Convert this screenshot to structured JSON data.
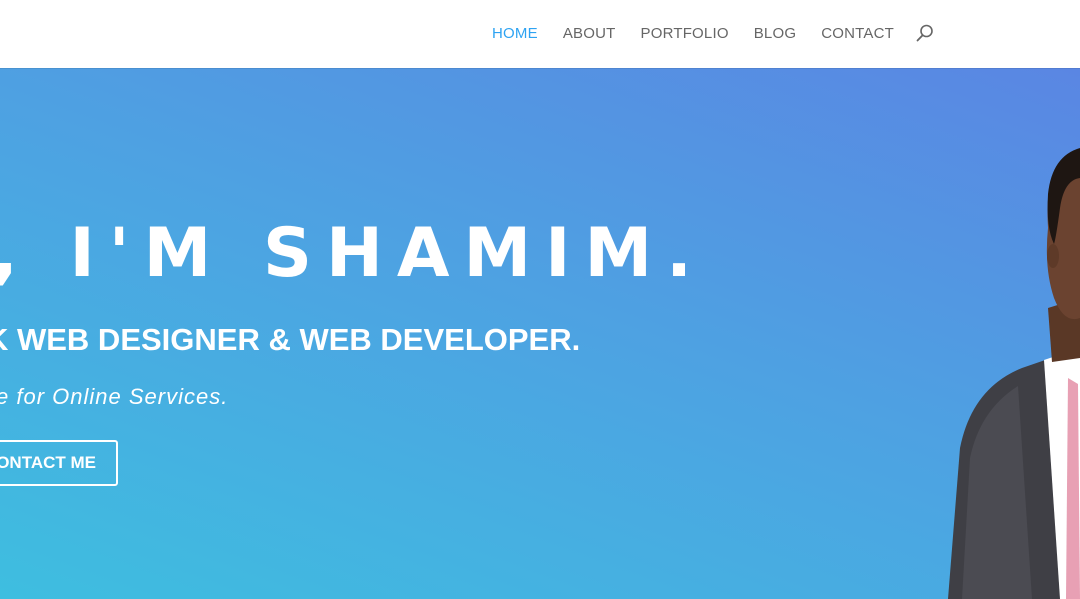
{
  "header": {
    "nav": [
      {
        "label": "HOME",
        "active": true
      },
      {
        "label": "ABOUT",
        "active": false
      },
      {
        "label": "PORTFOLIO",
        "active": false
      },
      {
        "label": "BLOG",
        "active": false
      },
      {
        "label": "CONTACT",
        "active": false
      }
    ],
    "search_icon": "search-icon"
  },
  "hero": {
    "title": ", I'M SHAMIM.",
    "subtitle": "K WEB DESIGNER & WEB DEVELOPER.",
    "tagline": "e for Online Services.",
    "button_label": "ONTACT ME"
  },
  "colors": {
    "nav_active": "#2ea3f2",
    "nav_default": "#666666",
    "hero_gradient_start": "#5a86e3",
    "hero_gradient_end": "#3ebee0",
    "hero_text": "#ffffff"
  }
}
